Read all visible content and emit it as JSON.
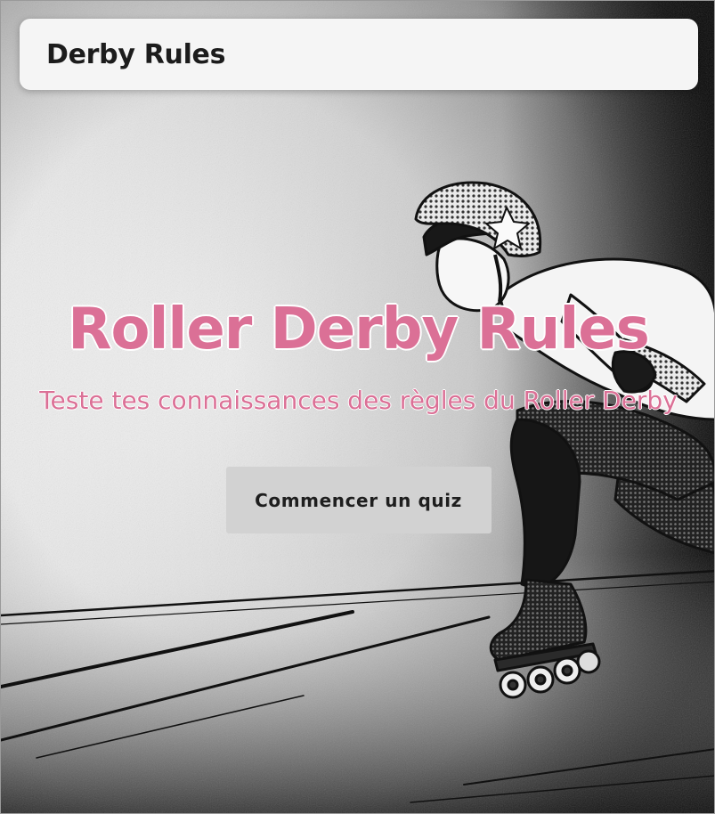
{
  "header": {
    "brand": "Derby Rules"
  },
  "hero": {
    "title": "Roller Derby Rules",
    "subtitle": "Teste tes connaissances des règles du Roller Derby",
    "cta_label": "Commencer un quiz"
  },
  "colors": {
    "accent": "#db7096",
    "button_bg": "#d2d2d2",
    "nav_bg": "#f5f5f5"
  }
}
